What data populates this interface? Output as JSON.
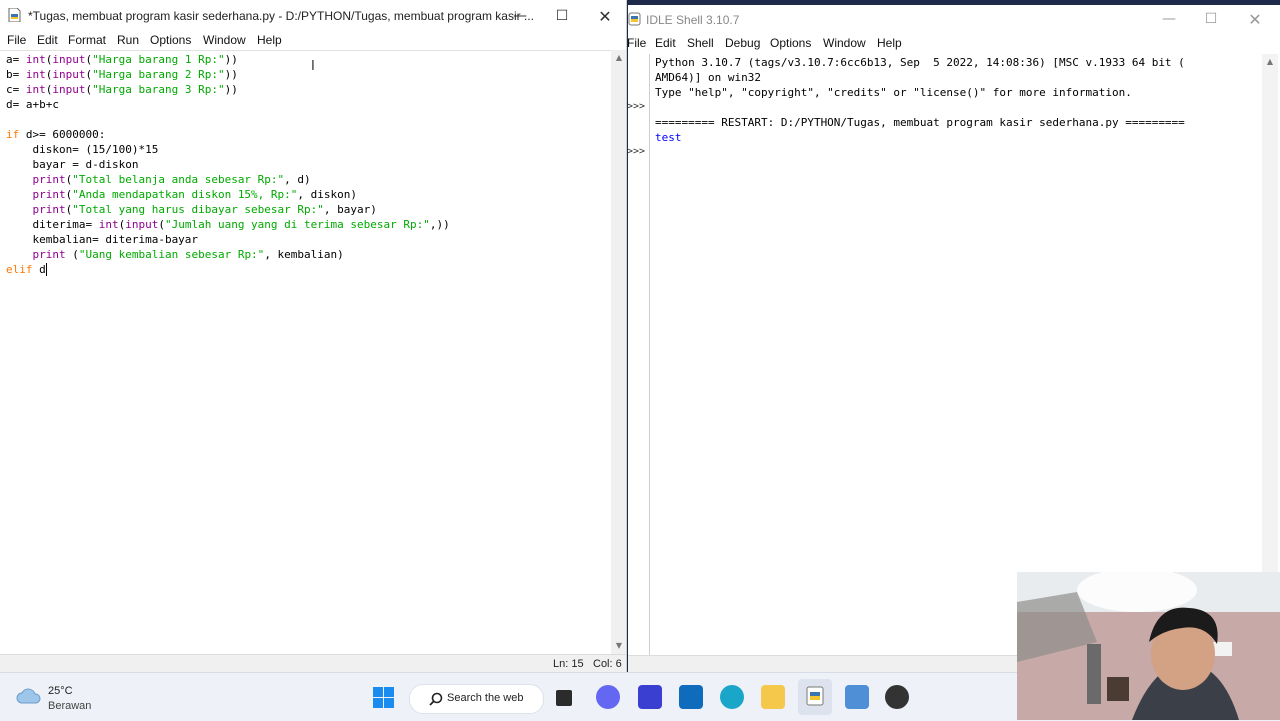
{
  "editor": {
    "title": "*Tugas, membuat program kasir sederhana.py - D:/PYTHON/Tugas, membuat program kasir ...",
    "menu": [
      "File",
      "Edit",
      "Format",
      "Run",
      "Options",
      "Window",
      "Help"
    ],
    "code_lines": [
      "a= int(input(\"Harga barang 1 Rp:\"))",
      "b= int(input(\"Harga barang 2 Rp:\"))",
      "c= int(input(\"Harga barang 3 Rp:\"))",
      "d= a+b+c",
      "",
      "if d>= 6000000:",
      "    diskon= (15/100)*15",
      "    bayar = d-diskon",
      "    print(\"Total belanja anda sebesar Rp:\", d)",
      "    print(\"Anda mendapatkan diskon 15%, Rp:\", diskon)",
      "    print(\"Total yang harus dibayar sebesar Rp:\", bayar)",
      "    diterima= int(input(\"Jumlah uang yang di terima sebesar Rp:\",))",
      "    kembalian= diterima-bayar",
      "    print (\"Uang kembalian sebesar Rp:\", kembalian)",
      "elif d"
    ],
    "status": {
      "line": "Ln: 15",
      "col": "Col: 6"
    }
  },
  "shell": {
    "title": "IDLE Shell 3.10.7",
    "menu": [
      "File",
      "Edit",
      "Shell",
      "Debug",
      "Options",
      "Window",
      "Help"
    ],
    "prompts": [
      ">>>",
      ">>>"
    ],
    "output_lines": [
      "Python 3.10.7 (tags/v3.10.7:6cc6b13, Sep  5 2022, 14:08:36) [MSC v.1933 64 bit (",
      "AMD64)] on win32",
      "Type \"help\", \"copyright\", \"credits\" or \"license()\" for more information.",
      "",
      "========= RESTART: D:/PYTHON/Tugas, membuat program kasir sederhana.py =========",
      "test"
    ]
  },
  "taskbar": {
    "weather_temp": "25°C",
    "weather_desc": "Berawan",
    "search_label": "Search the web"
  },
  "colors": {
    "keyword": "#ff7700",
    "builtin": "#900090",
    "string": "#00aa00",
    "shell_output": "#0000ff"
  }
}
